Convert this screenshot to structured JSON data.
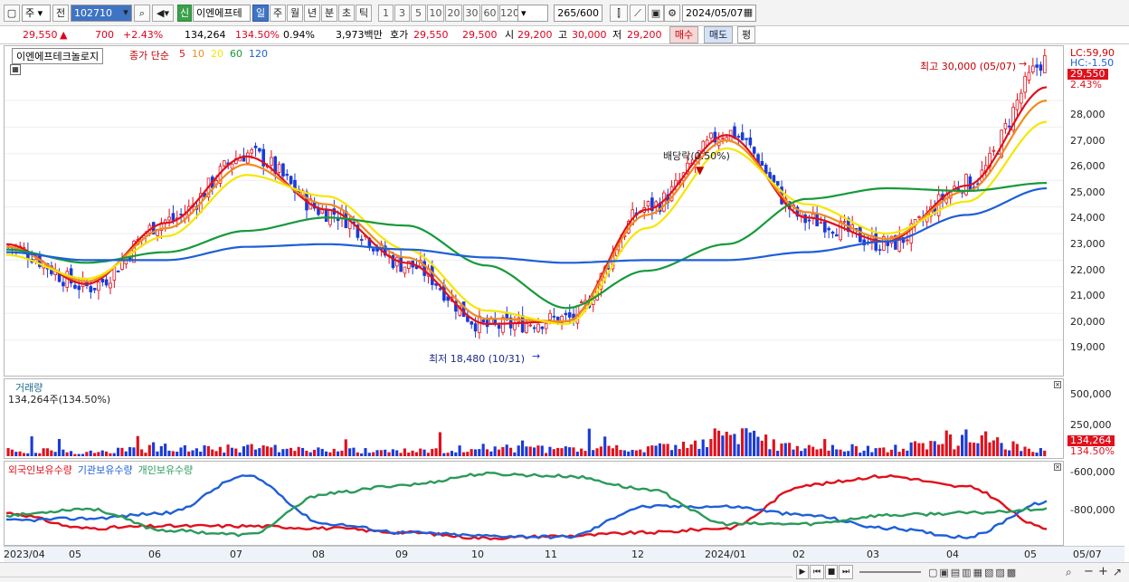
{
  "toolbar": {
    "period_sel": "주",
    "prev_label": "전",
    "code": "102710",
    "stock_name": "이엔에프테",
    "credit_badge": "신",
    "tf_buttons": [
      "일",
      "주",
      "월",
      "년",
      "분",
      "초",
      "틱"
    ],
    "num_buttons": [
      "1",
      "3",
      "5",
      "10",
      "20",
      "30",
      "60",
      "120"
    ],
    "count_display": "265",
    "count_total": "/600",
    "date": "2024/05/07"
  },
  "quote": {
    "price": "29,550",
    "change": "700",
    "change_pct": "+2.43%",
    "volume": "134,264",
    "volume_ratio": "134.50%",
    "turnover": "0.94%",
    "amount": "3,973백만",
    "ask_label": "호가",
    "ask": "29,550",
    "bid": "29,500",
    "open_label": "시",
    "open": "29,200",
    "high_label": "고",
    "high": "30,000",
    "low_label": "저",
    "low": "29,200",
    "buy_button": "매수",
    "sell_button": "매도",
    "eval_button": "평"
  },
  "price_pane": {
    "stock_title": "이엔에프테크놀로지",
    "ma_label": "종가 단순",
    "ma_periods": [
      "5",
      "10",
      "20",
      "60",
      "120"
    ],
    "ma_colors": [
      "#e0101c",
      "#f08b1c",
      "#f5e600",
      "#159a3a",
      "#1e5fd8"
    ],
    "lc_label": "LC:59,90",
    "hc_label": "HC:-1.50",
    "current_tag": "29,550",
    "current_pct": "2.43%",
    "y_ticks": [
      "28,000",
      "27,000",
      "26,000",
      "25,000",
      "24,000",
      "23,000",
      "22,000",
      "21,000",
      "20,000",
      "19,000"
    ],
    "high_annotation": "최고 30,000 (05/07)",
    "low_annotation": "최저 18,480 (10/31)",
    "dividend_annotation": "배당락(0.50%)"
  },
  "volume_pane": {
    "title": "거래량",
    "value_label": "134,264주(134.50%)",
    "y_ticks": [
      "500,000",
      "250,000"
    ],
    "current_tag": "134,264",
    "current_pct": "134.50%"
  },
  "holding_pane": {
    "series": [
      {
        "name": "외국인보유수량",
        "color": "#e0101c"
      },
      {
        "name": "기관보유수량",
        "color": "#1e5fd8"
      },
      {
        "name": "개인보유수량",
        "color": "#2a9a5a"
      }
    ],
    "y_ticks": [
      "-600,000",
      "-800,000"
    ]
  },
  "x_axis": {
    "labels": [
      "2023/04",
      "05",
      "06",
      "07",
      "08",
      "09",
      "10",
      "11",
      "12",
      "2024/01",
      "02",
      "03",
      "04",
      "05",
      "05/07"
    ]
  },
  "chart_data": {
    "type": "line",
    "title": "이엔에프테크놀로지",
    "x": [
      "2023/04",
      "05",
      "06",
      "07",
      "08",
      "09",
      "10",
      "11",
      "12",
      "2024/01",
      "02",
      "03",
      "04",
      "05"
    ],
    "series": [
      {
        "name": "종가",
        "values": [
          22500,
          21000,
          23500,
          26000,
          23800,
          21800,
          19500,
          19800,
          24000,
          26800,
          23500,
          22600,
          24900,
          29550
        ]
      },
      {
        "name": "5",
        "values": [
          22600,
          21100,
          23400,
          25900,
          23900,
          21900,
          19600,
          19700,
          23900,
          26700,
          23600,
          22700,
          24800,
          28500
        ]
      },
      {
        "name": "10",
        "values": [
          22500,
          21200,
          23200,
          25600,
          24100,
          22100,
          19800,
          19700,
          23700,
          26500,
          23800,
          22800,
          24600,
          28000
        ]
      },
      {
        "name": "20",
        "values": [
          22200,
          21300,
          22900,
          25200,
          24400,
          22400,
          20100,
          19600,
          23200,
          26200,
          24100,
          23000,
          24200,
          27200
        ]
      },
      {
        "name": "60",
        "values": [
          22400,
          21900,
          22300,
          23100,
          23600,
          23300,
          21800,
          20200,
          21600,
          22600,
          24300,
          24700,
          24600,
          24900
        ]
      },
      {
        "name": "120",
        "values": [
          22300,
          22000,
          22000,
          22500,
          22600,
          22400,
          22100,
          21900,
          22000,
          22000,
          22300,
          22700,
          23700,
          24700
        ]
      }
    ],
    "ylim": [
      18000,
      29700
    ],
    "volume": {
      "values": [
        140000,
        90000,
        210000,
        170000,
        120000,
        110000,
        180000,
        150000,
        160000,
        500000,
        190000,
        160000,
        400000,
        134264
      ],
      "ylim": [
        0,
        560000
      ]
    },
    "holdings": {
      "ylim": [
        -920000,
        -570000
      ],
      "series": [
        {
          "name": "외국인보유수량",
          "values": [
            -790000,
            -860000,
            -850000,
            -850000,
            -860000,
            -880000,
            -905000,
            -895000,
            -880000,
            -860000,
            -660000,
            -620000,
            -670000,
            -860000
          ]
        },
        {
          "name": "기관보유수량",
          "values": [
            -825000,
            -815000,
            -790000,
            -620000,
            -840000,
            -880000,
            -895000,
            -900000,
            -760000,
            -760000,
            -800000,
            -860000,
            -900000,
            -740000
          ]
        },
        {
          "name": "개인보유수량",
          "values": [
            -800000,
            -770000,
            -870000,
            -890000,
            -700000,
            -660000,
            -610000,
            -620000,
            -680000,
            -840000,
            -840000,
            -800000,
            -790000,
            -770000
          ]
        }
      ]
    }
  }
}
